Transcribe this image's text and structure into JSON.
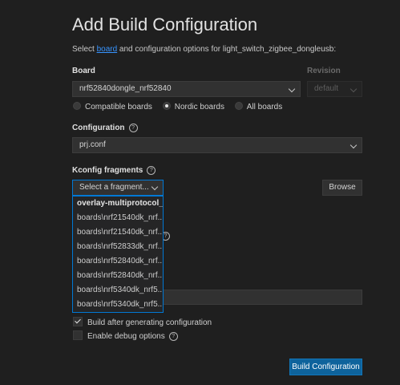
{
  "page": {
    "title": "Add Build Configuration",
    "intro_before": "Select ",
    "intro_link": "board",
    "intro_after": " and configuration options for light_switch_zigbee_dongleusb:"
  },
  "board": {
    "label": "Board",
    "value": "nrf52840dongle_nrf52840",
    "revision_label": "Revision",
    "revision_value": "default",
    "filters": [
      {
        "label": "Compatible boards",
        "selected": false
      },
      {
        "label": "Nordic boards",
        "selected": true
      },
      {
        "label": "All boards",
        "selected": false
      }
    ]
  },
  "configuration": {
    "label": "Configuration",
    "value": "prj.conf"
  },
  "kconfig": {
    "label": "Kconfig fragments",
    "placeholder": "Select a fragment...",
    "browse_label": "Browse",
    "options": [
      "overlay-multiprotocol_...",
      "boards\\nrf21540dk_nrf...",
      "boards\\nrf21540dk_nrf...",
      "boards\\nrf52833dk_nrf...",
      "boards\\nrf52840dk_nrf...",
      "boards\\nrf52840dk_nrf...",
      "boards\\nrf5340dk_nrf5...",
      "boards\\nrf5340dk_nrf5..."
    ]
  },
  "options": {
    "build_after": {
      "label": "Build after generating configuration",
      "checked": true
    },
    "debug": {
      "label": "Enable debug options",
      "checked": false
    }
  },
  "actions": {
    "build_label": "Build Configuration"
  }
}
